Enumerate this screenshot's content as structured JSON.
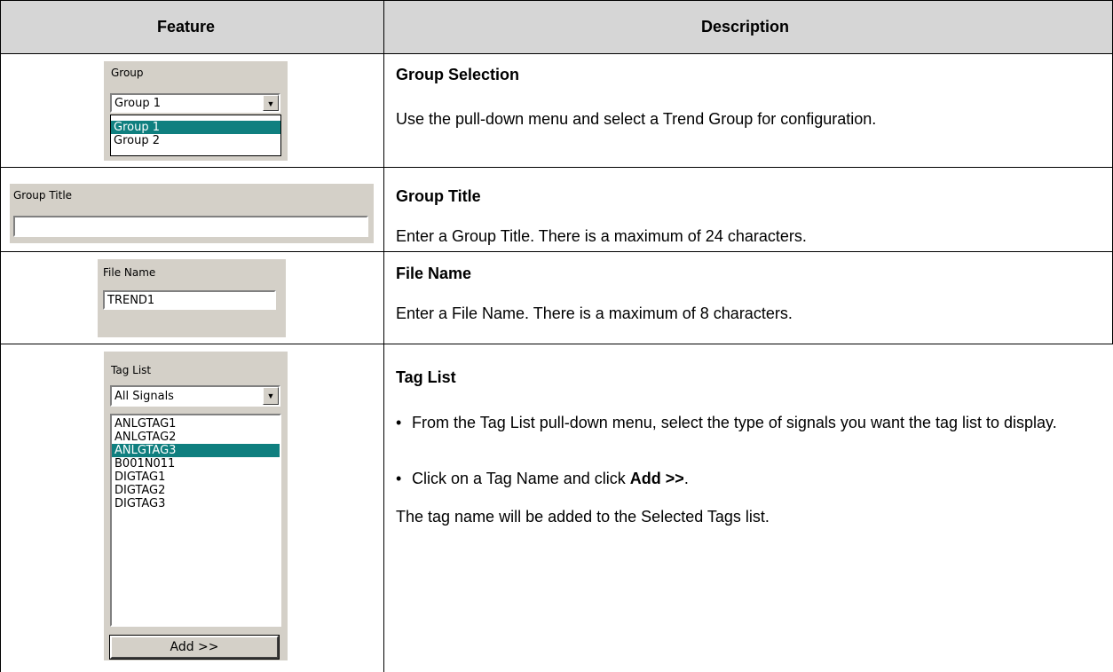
{
  "header": {
    "feature": "Feature",
    "description": "Description"
  },
  "rows": [
    {
      "title": "Group Selection",
      "text": "Use the pull-down menu and select a Trend Group for configuration.",
      "widget": {
        "label": "Group",
        "value": "Group 1",
        "options": [
          "Group 1",
          "Group 2"
        ],
        "selected_option": "Group 1"
      }
    },
    {
      "title": "Group Title",
      "text": "Enter a Group Title. There is a maximum of 24 characters.",
      "widget": {
        "label": "Group Title",
        "value": ""
      }
    },
    {
      "title": "File Name",
      "text": "Enter a File Name. There is a maximum of 8 characters.",
      "widget": {
        "label": "File Name",
        "value": "TREND1"
      }
    },
    {
      "title": "Tag List",
      "bullets": [
        "From the Tag List pull-down menu, select the type of signals you want the tag list to display.",
        "Click on a Tag Name and click"
      ],
      "bullet2_bold": "Add >>",
      "bullet2_tail": ".",
      "text": "The tag name will be added to the Selected Tags list.",
      "widget": {
        "label": "Tag List",
        "dropdown_value": "All Signals",
        "tags": [
          "ANLGTAG1",
          "ANLGTAG2",
          "ANLGTAG3",
          "B001N011",
          "DIGTAG1",
          "DIGTAG2",
          "DIGTAG3"
        ],
        "selected_tag": "ANLGTAG3",
        "add_button": "Add >>"
      }
    }
  ],
  "colors": {
    "header_bg": "#d6d6d6",
    "panel_bg": "#d4d0c8",
    "selection": "#0f7f7f"
  },
  "icons": {
    "dropdown_arrow": "chevron-down-icon"
  }
}
